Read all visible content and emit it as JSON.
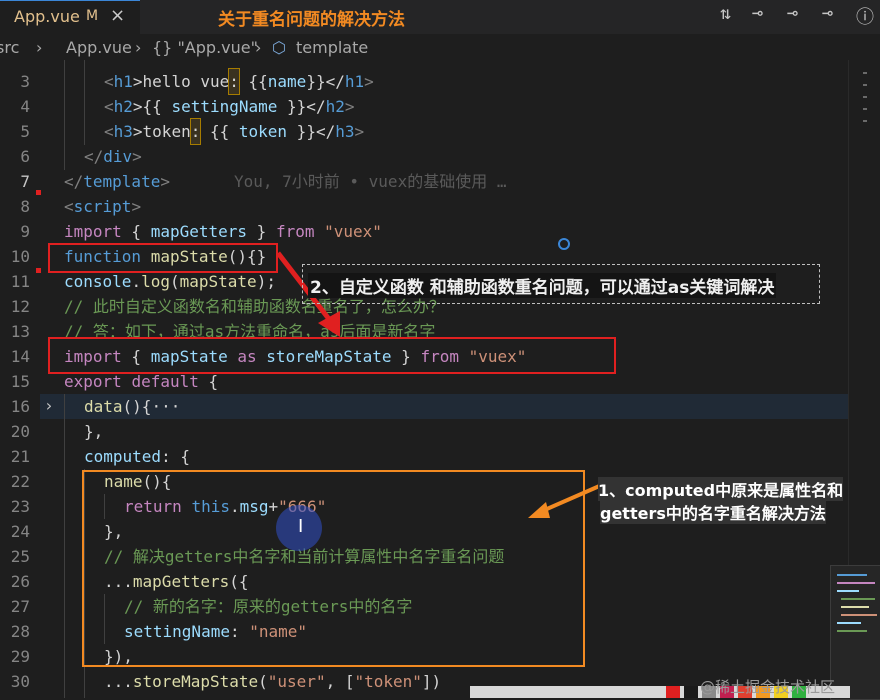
{
  "tab": {
    "title": "App.vue",
    "status": "M",
    "close": "×"
  },
  "title_annotation": "关于重名问题的解决方法",
  "toolbar_icons": [
    "⇅",
    "⊸",
    "⊸",
    "⊸",
    "ⓘ"
  ],
  "breadcrumb": {
    "part1": "src",
    "sep1": "›",
    "part2": "App.vue",
    "sep2": "›",
    "part3": "{} \"App.vue\"",
    "sep3": "›",
    "part4": "template"
  },
  "lines": [
    "3",
    "4",
    "5",
    "6",
    "7",
    "8",
    "9",
    "10",
    "11",
    "12",
    "13",
    "14",
    "15",
    "16",
    "20",
    "21",
    "22",
    "23",
    "24",
    "25",
    "26",
    "27",
    "28",
    "29",
    "30"
  ],
  "code": {
    "l3": {
      "a": "<",
      "b": "h1",
      "c": ">hello vue",
      "d": ":",
      "e": " {{",
      "f": "name",
      "g": "}}</",
      "h": "h1",
      "i": ">"
    },
    "l4": {
      "a": "<",
      "b": "h2",
      "c": ">{{ ",
      "d": "settingName",
      "e": " }}</",
      "f": "h2",
      "g": ">"
    },
    "l5": {
      "a": "<",
      "b": "h3",
      "c": ">token",
      "d": ":",
      "e": " {{ ",
      "f": "token",
      "g": " }}</",
      "h": "h3",
      "i": ">"
    },
    "l6": {
      "a": "</",
      "b": "div",
      "c": ">"
    },
    "l7": {
      "a": "</",
      "b": "template",
      "c": ">",
      "ghost": "You, 7小时前 • vuex的基础使用 …"
    },
    "l8": {
      "a": "<",
      "b": "script",
      "c": ">"
    },
    "l9": {
      "a": "import",
      "b": " { ",
      "c": "mapGetters",
      "d": " } ",
      "e": "from",
      "f": " ",
      "g": "\"vuex\""
    },
    "l10": {
      "a": "function",
      "b": " ",
      "c": "mapState",
      "d": "(){}"
    },
    "l11": {
      "a": "console",
      "b": ".",
      "c": "log",
      "d": "(",
      "e": "mapState",
      "f": ");"
    },
    "l12": {
      "a": "// 此时自定义函数名和辅助函数名重名了，怎么办？"
    },
    "l13": {
      "a": "// 答：如下，通过as方法重命名，as后面是新名字"
    },
    "l14": {
      "a": "import",
      "b": " { ",
      "c": "mapState",
      "d": " as ",
      "e": "storeMapState",
      "f": " } ",
      "g": "from",
      "h": " ",
      "i": "\"vuex\""
    },
    "l15": {
      "a": "export",
      "b": " ",
      "c": "default",
      "d": " {"
    },
    "l16": {
      "a": "data",
      "b": "(){",
      "c": "···"
    },
    "l20": {
      "a": "},"
    },
    "l21": {
      "a": "computed",
      "b": ": {"
    },
    "l22": {
      "a": "name",
      "b": "(){"
    },
    "l23": {
      "a": "return",
      "b": " ",
      "c": "this",
      "d": ".",
      "e": "msg",
      "f": "+",
      "g": "\"666\""
    },
    "l24": {
      "a": "},"
    },
    "l25": {
      "a": "// 解决getters中名字和当前计算属性中名字重名问题"
    },
    "l26": {
      "a": "...",
      "b": "mapGetters",
      "c": "({"
    },
    "l27": {
      "a": "// 新的名字：原来的getters中的名字"
    },
    "l28": {
      "a": "settingName",
      "b": ": ",
      "c": "\"name\""
    },
    "l29": {
      "a": "}),"
    },
    "l30": {
      "a": "...",
      "b": "storeMapState",
      "c": "(",
      "d": "\"user\"",
      "e": ", [",
      "f": "\"token\"",
      "g": "])"
    }
  },
  "annotations": {
    "a2": "2、自定义函数 和辅助函数重名问题，可以通过as关键词解决",
    "a1_line1": "1、computed中原来是属性名和",
    "a1_line2": "getters中的名字重名解决方法"
  },
  "watermark": "@稀土掘金技术社区",
  "colors": {
    "red": "#e02020",
    "orange": "#f28a22",
    "accent": "#3b86d6"
  }
}
